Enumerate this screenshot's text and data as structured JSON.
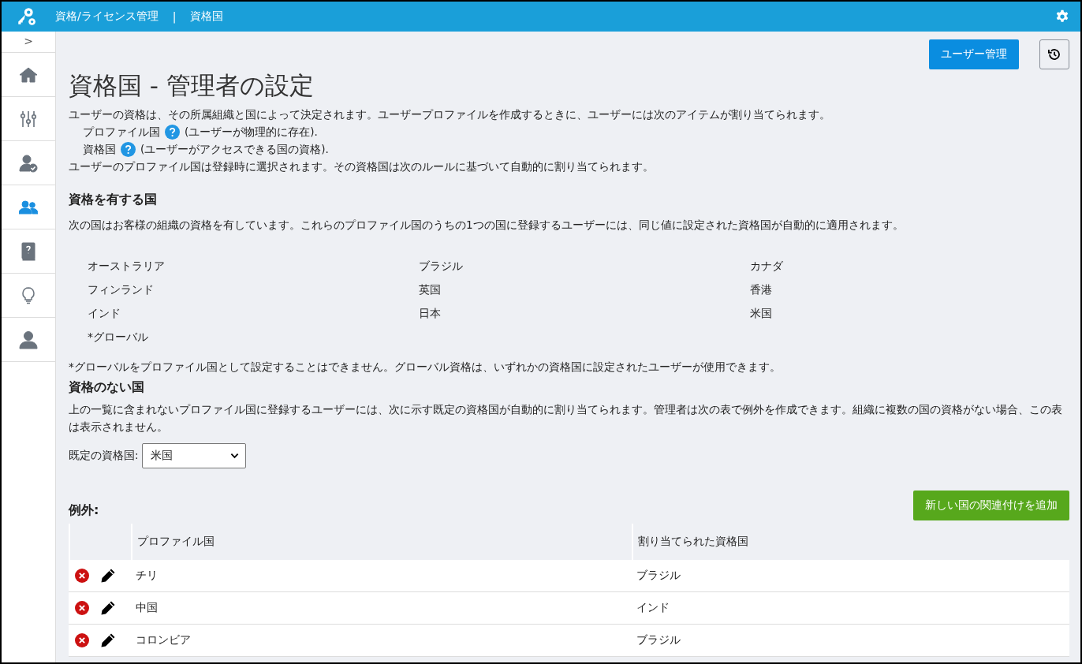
{
  "header": {
    "app_title": "資格/ライセンス管理",
    "separator": "|",
    "page": "資格国"
  },
  "sidebar": {
    "toggle": ">",
    "items": [
      {
        "kind": "home",
        "selected": false
      },
      {
        "kind": "sliders",
        "selected": false
      },
      {
        "kind": "user-check",
        "selected": false
      },
      {
        "kind": "users",
        "selected": true
      },
      {
        "kind": "help-book",
        "selected": false
      },
      {
        "kind": "bulb",
        "selected": false
      },
      {
        "kind": "user",
        "selected": false
      }
    ]
  },
  "toolbar": {
    "user_management": "ユーザー管理"
  },
  "title": "資格国 - 管理者の設定",
  "intro": {
    "line1": "ユーザーの資格は、その所属組織と国によって決定されます。ユーザープロファイルを作成するときに、ユーザーには次のアイテムが割り当てられます。",
    "items": [
      {
        "label": "プロファイル国",
        "note": "(ユーザーが物理的に存在)."
      },
      {
        "label": "資格国",
        "note": "(ユーザーがアクセスできる国の資格)."
      }
    ],
    "line2": "ユーザーのプロファイル国は登録時に選択されます。その資格国は次のルールに基づいて自動的に割り当てられます。"
  },
  "licensed": {
    "heading": "資格を有する国",
    "description": "次の国はお客様の組織の資格を有しています。これらのプロファイル国のうちの1つの国に登録するユーザーには、同じ値に設定された資格国が自動的に適用されます。",
    "countries": [
      "オーストラリア",
      "ブラジル",
      "カナダ",
      "フィンランド",
      "英国",
      "香港",
      "インド",
      "日本",
      "米国",
      "*グローバル"
    ],
    "footnote": "*グローバルをプロファイル国として設定することはできません。グローバル資格は、いずれかの資格国に設定されたユーザーが使用できます。"
  },
  "unlicensed": {
    "heading": "資格のない国",
    "description": "上の一覧に含まれないプロファイル国に登録するユーザーには、次に示す既定の資格国が自動的に割り当てられます。管理者は次の表で例外を作成できます。組織に複数の国の資格がない場合、この表は表示されません。",
    "default_label": "既定の資格国:",
    "default_value": "米国"
  },
  "exceptions": {
    "heading": "例外:",
    "add_button": "新しい国の関連付けを追加",
    "columns": [
      "プロファイル国",
      "割り当てられた資格国"
    ],
    "rows": [
      {
        "profile": "チリ",
        "assigned": "ブラジル"
      },
      {
        "profile": "中国",
        "assigned": "インド"
      },
      {
        "profile": "コロンビア",
        "assigned": "ブラジル"
      }
    ]
  }
}
